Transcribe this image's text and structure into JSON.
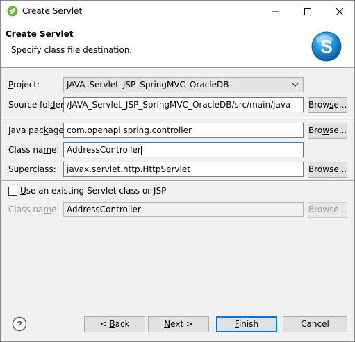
{
  "window": {
    "title": "Create Servlet"
  },
  "banner": {
    "title": "Create Servlet",
    "description": "Specify class file destination.",
    "logo_icon": "spring-servlet-logo-icon"
  },
  "form": {
    "project": {
      "label_pre": "",
      "label_mn": "P",
      "label_post": "roject:",
      "value": "JAVA_Servlet_JSP_SpringMVC_OracleDB"
    },
    "source_folder": {
      "label_pre": "Source fol",
      "label_mn": "d",
      "label_post": "er:",
      "value": "/JAVA_Servlet_JSP_SpringMVC_OracleDB/src/main/java",
      "browse_pre": "Brow",
      "browse_mn": "s",
      "browse_post": "e..."
    },
    "java_package": {
      "label_pre": "Java pac",
      "label_mn": "k",
      "label_post": "age:",
      "value": "com.openapi.spring.controller",
      "browse_pre": "Bro",
      "browse_mn": "w",
      "browse_post": "se..."
    },
    "class_name": {
      "label_pre": "Class na",
      "label_mn": "m",
      "label_post": "e:",
      "value": "AddressController"
    },
    "superclass": {
      "label_pre": "",
      "label_mn": "S",
      "label_post": "uperclass:",
      "value": "javax.servlet.http.HttpServlet",
      "browse_pre": "Brows",
      "browse_mn": "e",
      "browse_post": "..."
    },
    "use_existing": {
      "label_pre": "",
      "label_mn": "U",
      "label_post": "se an existing Servlet class or JSP",
      "checked": false
    },
    "existing_class_name": {
      "label_pre": "Class na",
      "label_mn": "m",
      "label_post": "e:",
      "value": "AddressController",
      "browse_label": "Browse..."
    }
  },
  "footer": {
    "help_icon": "help-question-icon",
    "back": {
      "pre": "< ",
      "mn": "B",
      "post": "ack"
    },
    "next": {
      "pre": "",
      "mn": "N",
      "post": "ext >"
    },
    "finish": {
      "pre": "",
      "mn": "F",
      "post": "inish"
    },
    "cancel": "Cancel"
  },
  "colors": {
    "accent": "#0078d7",
    "spring_green": "#6db33f",
    "logo_blue": "#1f8fd6"
  }
}
